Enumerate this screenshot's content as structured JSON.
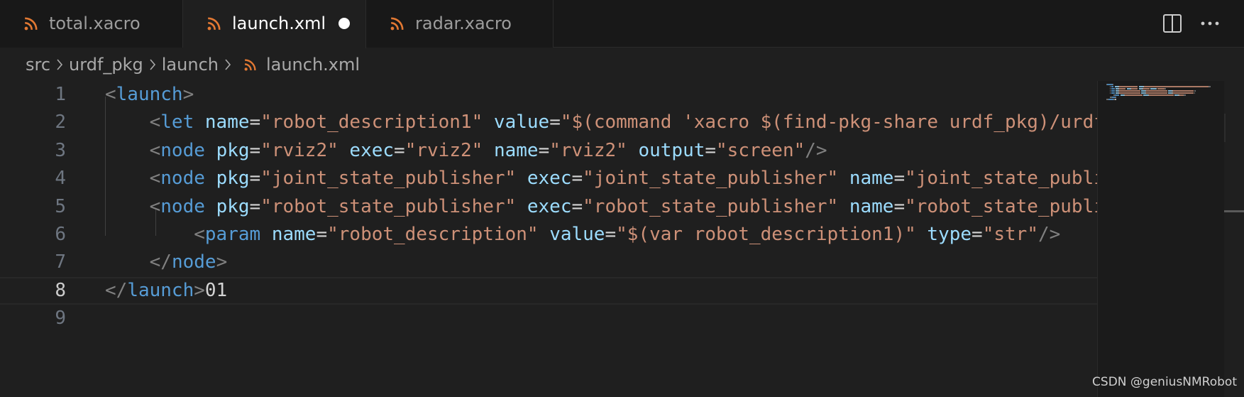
{
  "tabs": [
    {
      "label": "total.xacro",
      "active": false,
      "dirty": false
    },
    {
      "label": "launch.xml",
      "active": true,
      "dirty": true
    },
    {
      "label": "radar.xacro",
      "active": false,
      "dirty": false
    }
  ],
  "tab_actions": {
    "split_editor_icon": "split-editor-icon",
    "more_icon": "more-actions-icon"
  },
  "breadcrumb": {
    "items": [
      "src",
      "urdf_pkg",
      "launch"
    ],
    "file": "launch.xml",
    "file_icon": "rss-icon"
  },
  "colors": {
    "file_icon": "#e37933",
    "tag": "#569cd6",
    "attribute": "#9cdcfe",
    "string": "#ce9178",
    "bracket": "#808080"
  },
  "editor": {
    "current_line": 8,
    "lines": [
      {
        "num": "1",
        "tokens": [
          {
            "c": "br",
            "t": "<"
          },
          {
            "c": "tag",
            "t": "launch"
          },
          {
            "c": "br",
            "t": ">"
          }
        ]
      },
      {
        "num": "2",
        "tokens": [
          {
            "c": "txt",
            "t": "    "
          },
          {
            "c": "br",
            "t": "<"
          },
          {
            "c": "tag",
            "t": "let"
          },
          {
            "c": "txt",
            "t": " "
          },
          {
            "c": "at",
            "t": "name"
          },
          {
            "c": "eq",
            "t": "="
          },
          {
            "c": "str",
            "t": "\"robot_description1\""
          },
          {
            "c": "txt",
            "t": " "
          },
          {
            "c": "at",
            "t": "value"
          },
          {
            "c": "eq",
            "t": "="
          },
          {
            "c": "str",
            "t": "\"$(command 'xacro $(find-pkg-share urdf_pkg)/urdf/xacro/total.xacro')\""
          },
          {
            "c": "br",
            "t": "/>"
          }
        ]
      },
      {
        "num": "3",
        "tokens": [
          {
            "c": "txt",
            "t": "    "
          },
          {
            "c": "br",
            "t": "<"
          },
          {
            "c": "tag",
            "t": "node"
          },
          {
            "c": "txt",
            "t": " "
          },
          {
            "c": "at",
            "t": "pkg"
          },
          {
            "c": "eq",
            "t": "="
          },
          {
            "c": "str",
            "t": "\"rviz2\""
          },
          {
            "c": "txt",
            "t": " "
          },
          {
            "c": "at",
            "t": "exec"
          },
          {
            "c": "eq",
            "t": "="
          },
          {
            "c": "str",
            "t": "\"rviz2\""
          },
          {
            "c": "txt",
            "t": " "
          },
          {
            "c": "at",
            "t": "name"
          },
          {
            "c": "eq",
            "t": "="
          },
          {
            "c": "str",
            "t": "\"rviz2\""
          },
          {
            "c": "txt",
            "t": " "
          },
          {
            "c": "at",
            "t": "output"
          },
          {
            "c": "eq",
            "t": "="
          },
          {
            "c": "str",
            "t": "\"screen\""
          },
          {
            "c": "br",
            "t": "/>"
          }
        ]
      },
      {
        "num": "4",
        "tokens": [
          {
            "c": "txt",
            "t": "    "
          },
          {
            "c": "br",
            "t": "<"
          },
          {
            "c": "tag",
            "t": "node"
          },
          {
            "c": "txt",
            "t": " "
          },
          {
            "c": "at",
            "t": "pkg"
          },
          {
            "c": "eq",
            "t": "="
          },
          {
            "c": "str",
            "t": "\"joint_state_publisher\""
          },
          {
            "c": "txt",
            "t": " "
          },
          {
            "c": "at",
            "t": "exec"
          },
          {
            "c": "eq",
            "t": "="
          },
          {
            "c": "str",
            "t": "\"joint_state_publisher\""
          },
          {
            "c": "txt",
            "t": " "
          },
          {
            "c": "at",
            "t": "name"
          },
          {
            "c": "eq",
            "t": "="
          },
          {
            "c": "str",
            "t": "\"joint_state_publisher\""
          },
          {
            "c": "br",
            "t": "/>"
          }
        ]
      },
      {
        "num": "5",
        "tokens": [
          {
            "c": "txt",
            "t": "    "
          },
          {
            "c": "br",
            "t": "<"
          },
          {
            "c": "tag",
            "t": "node"
          },
          {
            "c": "txt",
            "t": " "
          },
          {
            "c": "at",
            "t": "pkg"
          },
          {
            "c": "eq",
            "t": "="
          },
          {
            "c": "str",
            "t": "\"robot_state_publisher\""
          },
          {
            "c": "txt",
            "t": " "
          },
          {
            "c": "at",
            "t": "exec"
          },
          {
            "c": "eq",
            "t": "="
          },
          {
            "c": "str",
            "t": "\"robot_state_publisher\""
          },
          {
            "c": "txt",
            "t": " "
          },
          {
            "c": "at",
            "t": "name"
          },
          {
            "c": "eq",
            "t": "="
          },
          {
            "c": "str",
            "t": "\"robot_state_publisher\""
          },
          {
            "c": "br",
            "t": ">"
          }
        ]
      },
      {
        "num": "6",
        "tokens": [
          {
            "c": "txt",
            "t": "        "
          },
          {
            "c": "br",
            "t": "<"
          },
          {
            "c": "tag",
            "t": "param"
          },
          {
            "c": "txt",
            "t": " "
          },
          {
            "c": "at",
            "t": "name"
          },
          {
            "c": "eq",
            "t": "="
          },
          {
            "c": "str",
            "t": "\"robot_description\""
          },
          {
            "c": "txt",
            "t": " "
          },
          {
            "c": "at",
            "t": "value"
          },
          {
            "c": "eq",
            "t": "="
          },
          {
            "c": "str",
            "t": "\"$(var robot_description1)\""
          },
          {
            "c": "txt",
            "t": " "
          },
          {
            "c": "at",
            "t": "type"
          },
          {
            "c": "eq",
            "t": "="
          },
          {
            "c": "str",
            "t": "\"str\""
          },
          {
            "c": "br",
            "t": "/>"
          }
        ]
      },
      {
        "num": "7",
        "tokens": [
          {
            "c": "txt",
            "t": "    "
          },
          {
            "c": "br",
            "t": "</"
          },
          {
            "c": "tag",
            "t": "node"
          },
          {
            "c": "br",
            "t": ">"
          }
        ]
      },
      {
        "num": "8",
        "tokens": [
          {
            "c": "br",
            "t": "</"
          },
          {
            "c": "tag",
            "t": "launch"
          },
          {
            "c": "br",
            "t": ">"
          },
          {
            "c": "txt",
            "t": "01"
          }
        ]
      },
      {
        "num": "9",
        "tokens": []
      }
    ]
  },
  "watermark": "CSDN @geniusNMRobot"
}
